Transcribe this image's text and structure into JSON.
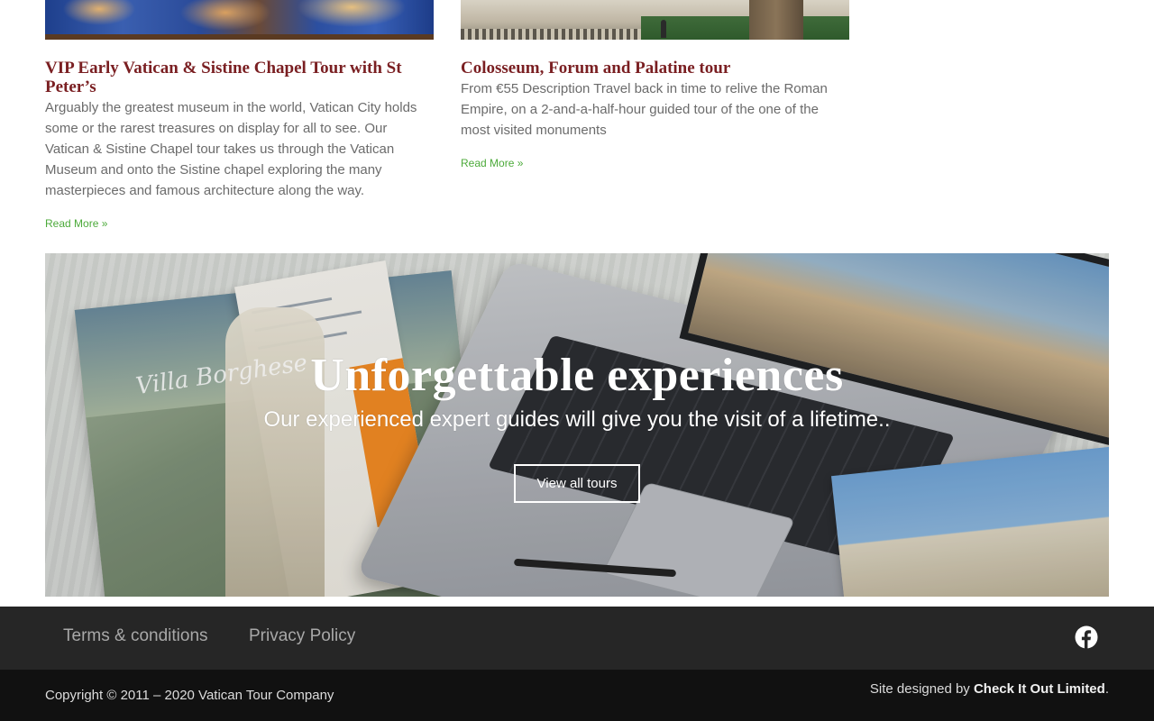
{
  "posts": [
    {
      "title": "VIP Early Vatican & Sistine Chapel Tour with St Peter’s",
      "excerpt": "Arguably the greatest museum in the world, Vatican City holds some or the rarest treasures on display for all to see. Our Vatican & Sistine Chapel tour takes us through the Vatican Museum and onto the Sistine chapel exploring the many masterpieces and famous architecture along the way.",
      "read_more": "Read More »"
    },
    {
      "title": "Colosseum, Forum and Palatine tour",
      "excerpt": "From €55 Description Travel back in time to relive the Roman Empire, on a 2-and-a-half-hour guided tour of the one of the most visited monuments",
      "read_more": "Read More »"
    }
  ],
  "hero": {
    "title": "Unforgettable experiences",
    "subtitle": "Our experienced expert guides will give you the visit of a lifetime..",
    "button_label": "View all tours",
    "image_text": "Villa Borghese"
  },
  "footer_nav": {
    "terms": "Terms & conditions",
    "privacy": "Privacy Policy",
    "social_icon": "facebook-icon"
  },
  "footer_bottom": {
    "copyright": "Copyright © 2011 – 2020 Vatican Tour Company",
    "designed_prefix": "Site designed by ",
    "designer": "Check It Out Limited",
    "designed_suffix": "."
  },
  "colors": {
    "title": "#7a1f22",
    "link_green": "#4caa3a",
    "footer_dark": "#262626",
    "footer_darker": "#111111"
  }
}
